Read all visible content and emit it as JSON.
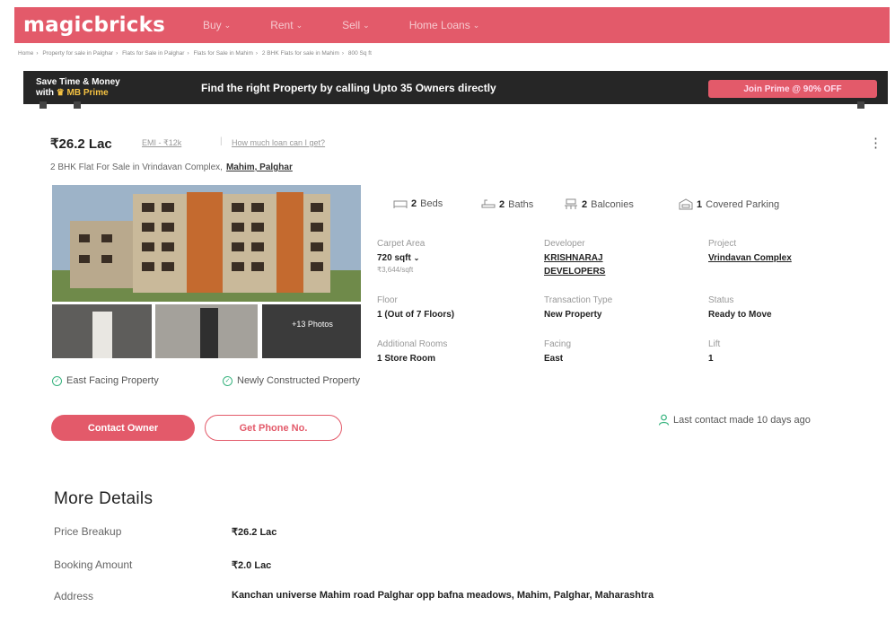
{
  "nav": {
    "logo": "magicbricks",
    "items": [
      "Buy",
      "Rent",
      "Sell",
      "Home Loans"
    ]
  },
  "breadcrumb": [
    "Home",
    "Property for sale in Palghar",
    "Flats for Sale in Palghar",
    "Flats for Sale in Mahim",
    "2 BHK Flats for sale in Mahim",
    "800 Sq ft"
  ],
  "prime_banner": {
    "line1": "Save Time & Money",
    "line2_prefix": "with",
    "line2_brand": "MB Prime",
    "message": "Find the right Property by calling Upto 35 Owners directly",
    "cta": "Join Prime @ 90% OFF"
  },
  "listing": {
    "price": "₹26.2 Lac",
    "emi": "EMI - ₹12k",
    "separator": "|",
    "loan_link": "How much loan can I get?",
    "more_icon": "⋮",
    "subtitle": "2 BHK Flat For Sale in Vrindavan Complex,",
    "location": "Mahim, Palghar",
    "photo_count_line1": "+13 Photos",
    "photo_count_line2": "",
    "amenities": [
      {
        "count": "2",
        "label": "Beds",
        "icon": "bed-icon"
      },
      {
        "count": "2",
        "label": "Baths",
        "icon": "bath-icon"
      },
      {
        "count": "2",
        "label": "Balconies",
        "icon": "balcony-icon"
      },
      {
        "count": "1",
        "label": "Covered Parking",
        "icon": "parking-icon"
      }
    ],
    "facts": {
      "carpet_area_label": "Carpet Area",
      "carpet_area_value": "720 sqft",
      "carpet_area_sub": "₹3,644/sqft",
      "developer_label": "Developer",
      "developer_value_1": "KRISHNARAJ",
      "developer_value_2": "DEVELOPERS",
      "project_label": "Project",
      "project_value": "Vrindavan Complex",
      "floor_label": "Floor",
      "floor_value": "1 (Out of 7 Floors)",
      "transaction_label": "Transaction Type",
      "transaction_value": "New Property",
      "status_label": "Status",
      "status_value": "Ready to Move",
      "additional_rooms_label": "Additional Rooms",
      "additional_rooms_value": "1 Store Room",
      "facing_label": "Facing",
      "facing_value": "East",
      "lift_label": "Lift",
      "lift_value": "1"
    },
    "tags": [
      "East Facing Property",
      "Newly Constructed Property"
    ],
    "contact_button": "Contact Owner",
    "phone_button": "Get Phone No.",
    "last_contact": "Last contact made 10 days ago"
  },
  "more_details": {
    "title": "More Details",
    "rows": [
      {
        "label": "Price Breakup",
        "value": "₹26.2 Lac"
      },
      {
        "label": "Booking Amount",
        "value": "₹2.0 Lac"
      },
      {
        "label": "Address",
        "value": "Kanchan universe Mahim road Palghar opp bafna meadows, Mahim, Palghar, Maharashtra"
      }
    ]
  },
  "colors": {
    "brand": "#e35a6a",
    "banner_bg": "#262626",
    "prime_gold": "#f5c242",
    "success": "#36b37e"
  }
}
